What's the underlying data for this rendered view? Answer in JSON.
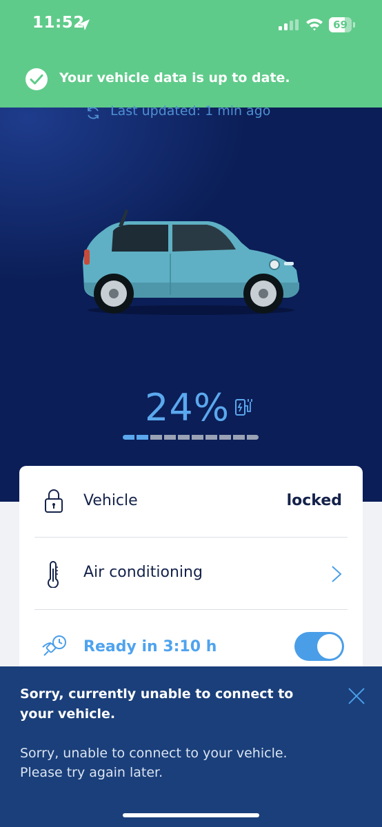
{
  "status_bar": {
    "time": "11:52",
    "battery_percent": "69",
    "icons": [
      "location-arrow-icon",
      "cellular-signal-icon",
      "wifi-icon",
      "battery-icon"
    ]
  },
  "banner": {
    "text": "Your vehicle data is up to date.",
    "icon": "check-circle-icon",
    "color": "#5fcb8a"
  },
  "vehicle": {
    "last_updated": "Last updated: 1 min ago",
    "charge_percent": "24%",
    "charge_level": 0.24,
    "charge_segments_total": 10,
    "charge_segments_filled": 2
  },
  "status_card": {
    "rows": [
      {
        "icon": "padlock-icon",
        "label": "Vehicle",
        "value": "locked"
      },
      {
        "icon": "thermometer-icon",
        "label": "Air conditioning",
        "action": "chevron-right-icon"
      },
      {
        "icon": "plug-clock-icon",
        "label": "Ready in 3:10 h",
        "toggle_on": true
      }
    ]
  },
  "error_panel": {
    "title": "Sorry, currently unable to connect to your vehicle.",
    "line1": "Sorry, unable to connect to your vehicle.",
    "line2": "Please try again later.",
    "icon": "close-icon"
  },
  "colors": {
    "hero_background": "#0b1e57",
    "accent_blue": "#4a9ee8",
    "error_panel": "#1a3f7a"
  }
}
